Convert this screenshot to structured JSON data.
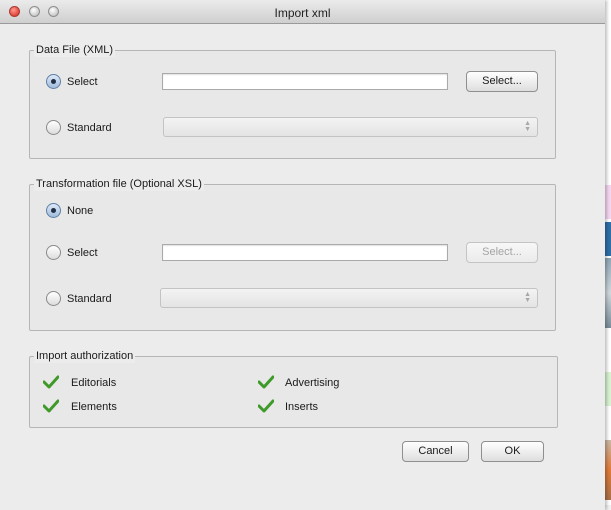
{
  "window": {
    "title": "Import xml"
  },
  "data_file": {
    "legend": "Data File (XML)",
    "select_label": "Select",
    "select_value": "",
    "browse_button": "Select...",
    "standard_label": "Standard",
    "standard_value": "",
    "selected": "select"
  },
  "transformation": {
    "legend": "Transformation file (Optional XSL)",
    "none_label": "None",
    "select_label": "Select",
    "select_value": "",
    "browse_button": "Select...",
    "standard_label": "Standard",
    "standard_value": "",
    "selected": "none"
  },
  "authorization": {
    "legend": "Import authorization",
    "items": [
      {
        "label": "Editorials",
        "checked": true
      },
      {
        "label": "Advertising",
        "checked": true
      },
      {
        "label": "Elements",
        "checked": true
      },
      {
        "label": "Inserts",
        "checked": true
      }
    ],
    "check_color": "#3f9a2a"
  },
  "buttons": {
    "cancel": "Cancel",
    "ok": "OK"
  },
  "icons": {
    "close": "close-icon",
    "minimize": "minimize-icon",
    "zoom": "zoom-icon",
    "check": "checkmark-icon",
    "stepper": "up-down-arrows-icon"
  }
}
